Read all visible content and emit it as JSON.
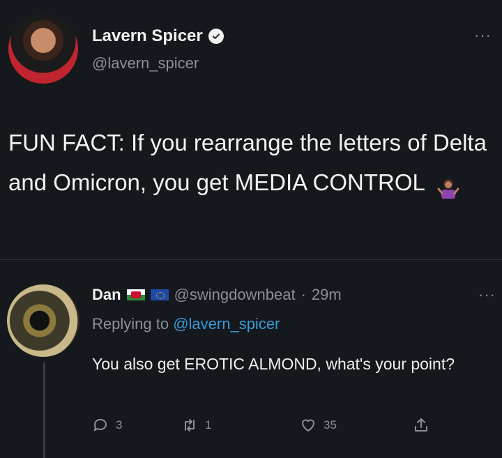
{
  "tweet": {
    "display_name": "Lavern Spicer",
    "handle": "@lavern_spicer",
    "text": "FUN FACT: If you rearrange the letters of Delta and Omicron, you get MEDIA CONTROL",
    "more_icon": "more-horizontal-icon"
  },
  "reply": {
    "display_name": "Dan",
    "handle": "@swingdownbeat",
    "separator": "·",
    "time": "29m",
    "replying_label": "Replying to",
    "replying_to": "@lavern_spicer",
    "text": "You also get EROTIC ALMOND, what's your point?",
    "actions": {
      "reply_count": "3",
      "retweet_count": "1",
      "like_count": "35"
    }
  },
  "colors": {
    "background": "#15181c",
    "text": "#e9eaeb",
    "muted": "#8b9196",
    "link": "#3a9bd8"
  }
}
